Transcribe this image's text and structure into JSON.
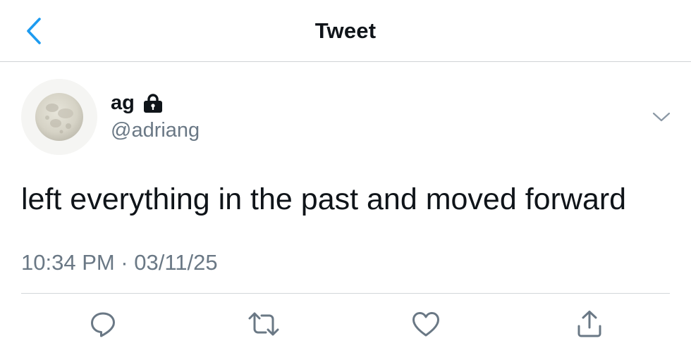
{
  "header": {
    "title": "Tweet",
    "back_icon": "chevron-left-icon",
    "accent_color": "#1d9bf0"
  },
  "tweet": {
    "author": {
      "display_name": "ag",
      "handle": "@adriang",
      "protected_icon": "lock-icon",
      "avatar": "moon-avatar"
    },
    "text": "left everything in the past and moved forward",
    "timestamp": "10:34 PM · 03/11/25",
    "more_icon": "chevron-down-icon"
  },
  "actions": [
    {
      "name": "reply",
      "icon": "reply-icon"
    },
    {
      "name": "retweet",
      "icon": "retweet-icon"
    },
    {
      "name": "like",
      "icon": "heart-icon"
    },
    {
      "name": "share",
      "icon": "share-icon"
    }
  ],
  "colors": {
    "text_primary": "#0f1419",
    "text_secondary": "#6a7885",
    "icon_gray": "#6a7885",
    "divider": "#cfd3d6"
  }
}
